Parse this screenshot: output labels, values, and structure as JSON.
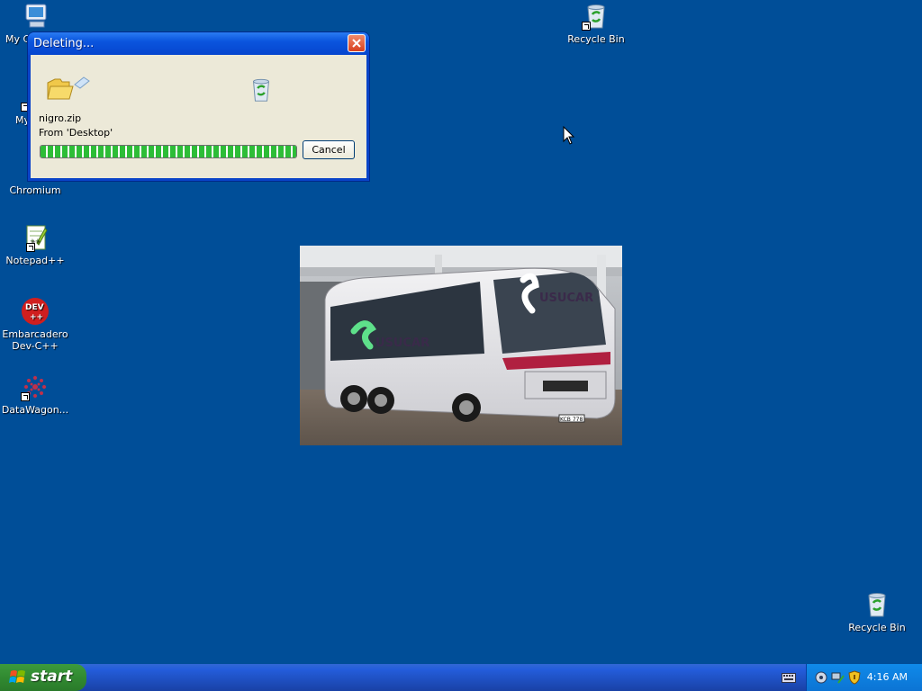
{
  "desktop": {
    "icons": [
      {
        "label": "My C",
        "icon": "my-computer-icon"
      },
      {
        "label": "My",
        "icon": "my-documents-icon"
      },
      {
        "label": "Chromium",
        "icon": "chromium-icon"
      },
      {
        "label": "Notepad++",
        "icon": "notepadpp-icon"
      },
      {
        "label": "Embarcadero",
        "label2": "Dev-C++",
        "icon": "devcpp-icon"
      },
      {
        "label": "DataWagon...",
        "icon": "datawagon-icon"
      },
      {
        "label": "Recycle Bin",
        "icon": "recycle-bin-icon"
      },
      {
        "label": "Recycle Bin",
        "icon": "recycle-bin-icon"
      }
    ]
  },
  "dialog": {
    "title": "Deleting...",
    "file_name": "nigro.zip",
    "from_text": "From 'Desktop'",
    "progress": 1.0,
    "cancel_label": "Cancel"
  },
  "photo": {
    "subject": "white coach bus",
    "sign_text": "USUCAR",
    "plate_text": "KCB 778"
  },
  "taskbar": {
    "start_label": "start",
    "clock": "4:16 AM"
  },
  "colors": {
    "desktop": "#004e98",
    "taskbar": "#245ddb",
    "start": "#318a31",
    "progress": "#2dbd37"
  }
}
